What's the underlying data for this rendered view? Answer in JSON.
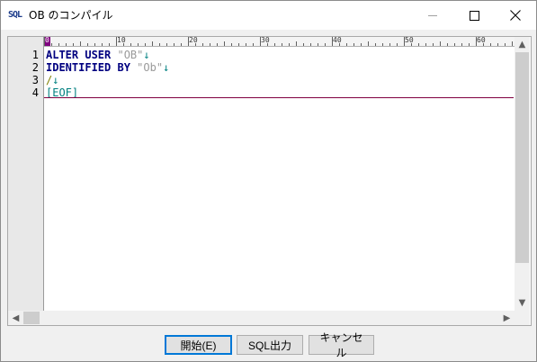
{
  "window": {
    "icon_text": "SQL",
    "title": "OB のコンパイル",
    "icons": {
      "minimize": "minimize-icon",
      "maximize": "maximize-icon",
      "close": "close-icon"
    }
  },
  "ruler": {
    "labels": [
      "0",
      "10",
      "20",
      "30",
      "40",
      "50",
      "60"
    ]
  },
  "editor": {
    "lines": [
      {
        "number": "1",
        "kw": "ALTER USER ",
        "str": "\"OB\"",
        "eol": "↓"
      },
      {
        "number": "2",
        "kw": "IDENTIFIED BY ",
        "str": "\"Ob\"",
        "eol": "↓"
      },
      {
        "number": "3",
        "slash": "/",
        "eol": "↓"
      },
      {
        "number": "4",
        "eof": "[EOF]"
      }
    ],
    "scroll_icons": {
      "up": "▲",
      "down": "▼",
      "left": "◀",
      "right": "▶"
    }
  },
  "buttons": {
    "start": "開始(E)",
    "sql_output": "SQL出力",
    "cancel": "キャンセル"
  },
  "colors": {
    "keyword": "#000080",
    "string": "#9a9a9a",
    "eol_marker": "#008080",
    "eof_line": "#800040",
    "default_button_border": "#0078d7"
  }
}
